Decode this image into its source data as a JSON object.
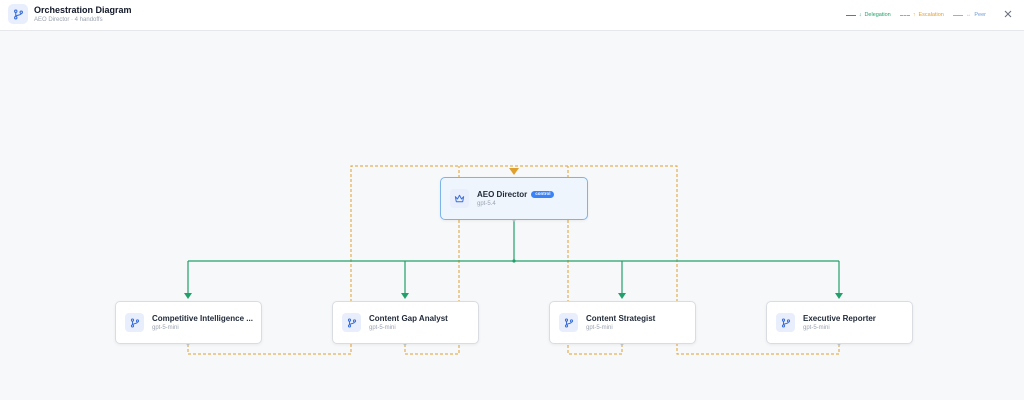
{
  "header": {
    "title": "Orchestration Diagram",
    "subtitle": "AEO Director · 4 handoffs",
    "icon": "branch-icon",
    "close_icon": "close-icon"
  },
  "legend": [
    {
      "label": "Delegation",
      "glyph": "↓",
      "color": "#22a06b",
      "style": "solid"
    },
    {
      "label": "Escalation",
      "glyph": "↑",
      "color": "#e0a030",
      "style": "dashed"
    },
    {
      "label": "Peer",
      "glyph": "↔",
      "color": "#8ab4e8",
      "style": "solid"
    }
  ],
  "colors": {
    "delegation": "#22a06b",
    "escalation": "#e0a030",
    "peer": "#8ab4e8",
    "badge": "#3b82f6",
    "root_border": "#7cb4ea"
  },
  "nodes": {
    "root": {
      "name": "AEO Director",
      "badge": "control",
      "model": "gpt-5.4",
      "icon": "crown-icon"
    },
    "children": [
      {
        "name": "Competitive Intelligence ...",
        "model": "gpt-5-mini",
        "icon": "branch-icon"
      },
      {
        "name": "Content Gap Analyst",
        "model": "gpt-5-mini",
        "icon": "branch-icon"
      },
      {
        "name": "Content Strategist",
        "model": "gpt-5-mini",
        "icon": "branch-icon"
      },
      {
        "name": "Executive Reporter",
        "model": "gpt-5-mini",
        "icon": "branch-icon"
      }
    ]
  }
}
